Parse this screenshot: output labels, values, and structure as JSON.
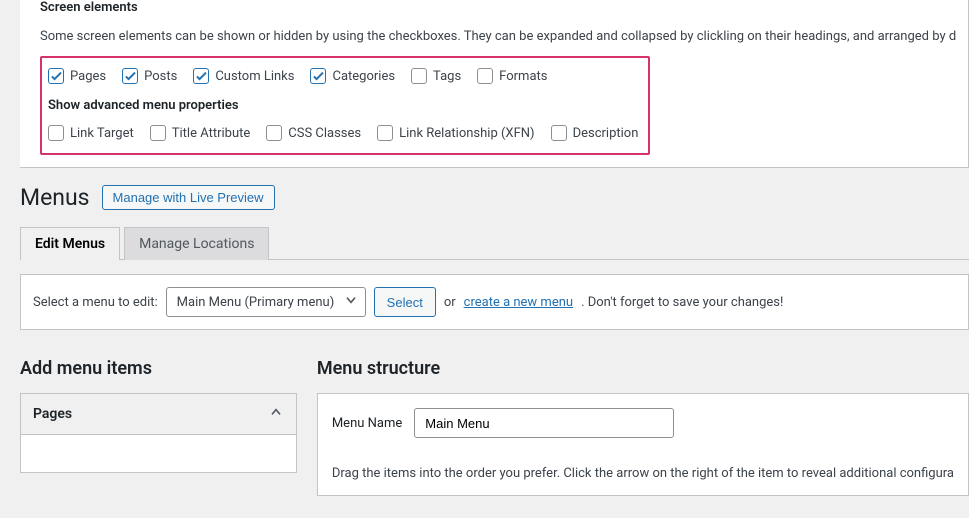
{
  "screen_options": {
    "heading": "Screen elements",
    "description": "Some screen elements can be shown or hidden by using the checkboxes. They can be expanded and collapsed by clickling on their headings, and arranged by d",
    "boxes_row": [
      {
        "label": "Pages",
        "checked": true
      },
      {
        "label": "Posts",
        "checked": true
      },
      {
        "label": "Custom Links",
        "checked": true
      },
      {
        "label": "Categories",
        "checked": true
      },
      {
        "label": "Tags",
        "checked": false
      },
      {
        "label": "Formats",
        "checked": false
      }
    ],
    "advanced_heading": "Show advanced menu properties",
    "advanced_row": [
      {
        "label": "Link Target",
        "checked": false
      },
      {
        "label": "Title Attribute",
        "checked": false
      },
      {
        "label": "CSS Classes",
        "checked": false
      },
      {
        "label": "Link Relationship (XFN)",
        "checked": false
      },
      {
        "label": "Description",
        "checked": false
      }
    ]
  },
  "page": {
    "title": "Menus",
    "live_preview_btn": "Manage with Live Preview",
    "tabs": {
      "edit": "Edit Menus",
      "locations": "Manage Locations"
    },
    "select_prompt": "Select a menu to edit:",
    "selected_menu": "Main Menu (Primary menu)",
    "select_btn": "Select",
    "or": "or",
    "create_link": "create a new menu",
    "save_reminder": ". Don't forget to save your changes!"
  },
  "left_col": {
    "heading": "Add menu items",
    "pages_label": "Pages"
  },
  "right_col": {
    "heading": "Menu structure",
    "menu_name_label": "Menu Name",
    "menu_name_value": "Main Menu",
    "hint": "Drag the items into the order you prefer. Click the arrow on the right of the item to reveal additional configura"
  }
}
